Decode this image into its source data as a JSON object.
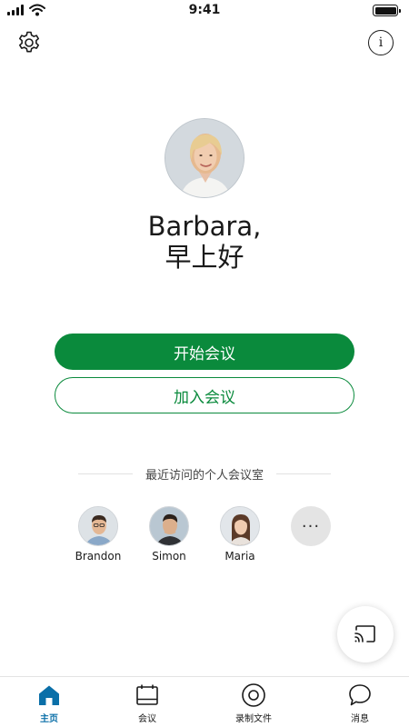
{
  "status_bar": {
    "time": "9:41"
  },
  "header": {
    "info_symbol": "i"
  },
  "greeting": {
    "name": "Barbara,",
    "message": "早上好"
  },
  "actions": {
    "start_label": "开始会议",
    "join_label": "加入会议"
  },
  "recent": {
    "title": "最近访问的个人会议室",
    "contacts": [
      {
        "name": "Brandon"
      },
      {
        "name": "Simon"
      },
      {
        "name": "Maria"
      }
    ],
    "more_symbol": "···"
  },
  "tabs": [
    {
      "label": "主页",
      "icon": "home-icon",
      "active": true
    },
    {
      "label": "会议",
      "icon": "calendar-icon",
      "active": false
    },
    {
      "label": "录制文件",
      "icon": "record-icon",
      "active": false
    },
    {
      "label": "消息",
      "icon": "chat-icon",
      "active": false
    }
  ],
  "colors": {
    "primary_green": "#0a8a3c",
    "active_tab_blue": "#0a6fa8"
  }
}
